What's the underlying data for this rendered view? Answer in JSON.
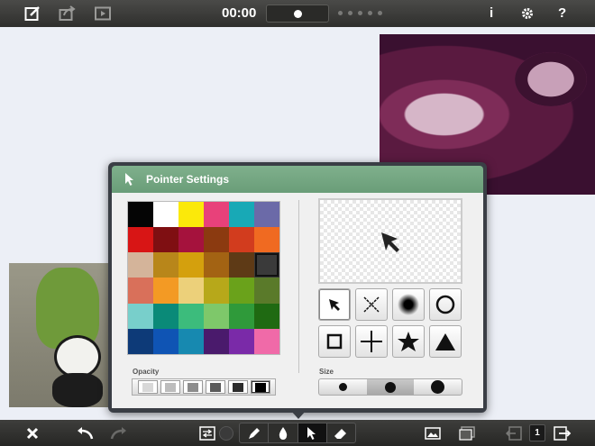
{
  "topbar": {
    "time": "00:00",
    "info_label": "i",
    "help_label": "?",
    "icons": [
      "edit-icon",
      "share-icon",
      "play-icon",
      "gear-icon"
    ],
    "slider_position": 0.5,
    "page_dots": 5
  },
  "popover": {
    "title": "Pointer Settings",
    "opacity_label": "Opacity",
    "size_label": "Size",
    "palette": [
      [
        "#050505",
        "#ffffff",
        "#fbe90a",
        "#e8417a",
        "#18a9b6",
        "#6b6aa8"
      ],
      [
        "#d81515",
        "#7f0f12",
        "#a5123d",
        "#8b3a10",
        "#d23c1e",
        "#f06a21"
      ],
      [
        "#d4b49a",
        "#b8861a",
        "#d4a00d",
        "#a36313",
        "#5e3a16",
        "#3a3a3a"
      ],
      [
        "#d9705a",
        "#f39a24",
        "#ecd07a",
        "#b7a81a",
        "#6aa21b",
        "#5a7a2a"
      ],
      [
        "#78cfcb",
        "#0a8a78",
        "#3cbc7c",
        "#7ec86a",
        "#2f9a3a",
        "#1f6a12"
      ],
      [
        "#0d3a78",
        "#0f54b4",
        "#1789b0",
        "#4a1a6c",
        "#7a2aa8",
        "#f06aa8"
      ]
    ],
    "selected_color": "#3a3a3a",
    "opacity_levels": [
      "#d8d8d8",
      "#bcbcbc",
      "#8c8c8c",
      "#5a5a5a",
      "#2c2c2c",
      "#000000"
    ],
    "selected_opacity_index": 5,
    "shapes": [
      "arrow-pointer",
      "x-cross",
      "soft-dot",
      "circle-outline",
      "square-outline",
      "plus",
      "star",
      "triangle"
    ],
    "selected_shape_index": 0,
    "sizes": [
      "small",
      "medium",
      "large"
    ],
    "selected_size_index": 1
  },
  "bottombar": {
    "page_number": "1",
    "active_tool": "pointer"
  }
}
